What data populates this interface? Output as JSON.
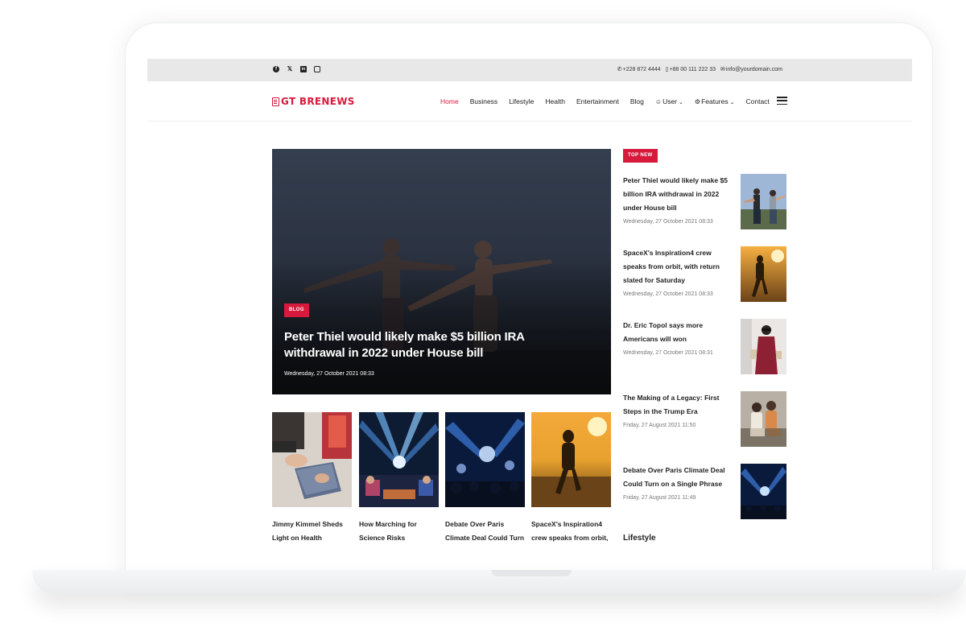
{
  "topbar": {
    "social_icons": [
      "facebook-icon",
      "twitter-icon",
      "linkedin-icon",
      "instagram-icon"
    ],
    "phone": "+228 872 4444",
    "mobile": "+88 00 111 222 33",
    "email": "info@yourdomain.com"
  },
  "header": {
    "logo_prefix": "GT",
    "logo_name": "BRENEWS",
    "nav": [
      {
        "label": "Home",
        "active": true
      },
      {
        "label": "Business"
      },
      {
        "label": "Lifestyle"
      },
      {
        "label": "Health"
      },
      {
        "label": "Entertainment"
      },
      {
        "label": "Blog"
      },
      {
        "label": "User"
      },
      {
        "label": "Features"
      },
      {
        "label": "Contact"
      }
    ]
  },
  "hero": {
    "category": "BLOG",
    "title": "Peter Thiel would likely make $5 billion IRA withdrawal in 2022 under House bill",
    "date": "Wednesday, 27 October 2021 08:33"
  },
  "cards": [
    {
      "title": "Jimmy Kimmel Sheds Light on Health Coverage"
    },
    {
      "title": "How Marching for Science Risks Politicizing It"
    },
    {
      "title": "Debate Over Paris Climate Deal Could Turn on a"
    },
    {
      "title": "SpaceX's Inspiration4 crew speaks from orbit,"
    }
  ],
  "sidebar": {
    "badge": "TOP NEW",
    "items": [
      {
        "title": "Peter Thiel would likely make $5 billion IRA withdrawal in 2022 under House bill",
        "date": "Wednesday, 27 October 2021 08:33"
      },
      {
        "title": "SpaceX's Inspiration4 crew speaks from orbit, with return slated for Saturday",
        "date": "Wednesday, 27 October 2021 08:33"
      },
      {
        "title": "Dr. Eric Topol says more Americans will won",
        "date": "Wednesday, 27 October 2021 08:31"
      },
      {
        "title": "The Making of a Legacy: First Steps in the Trump Era",
        "date": "Friday, 27 August 2021 11:50"
      },
      {
        "title": "Debate Over Paris Climate Deal Could Turn on a Single Phrase",
        "date": "Friday, 27 August 2021 11:49"
      }
    ],
    "section_heading": "Lifestyle"
  },
  "colors": {
    "accent": "#d71a3c",
    "topbar_bg": "#e8e8e8",
    "text": "#222222"
  }
}
